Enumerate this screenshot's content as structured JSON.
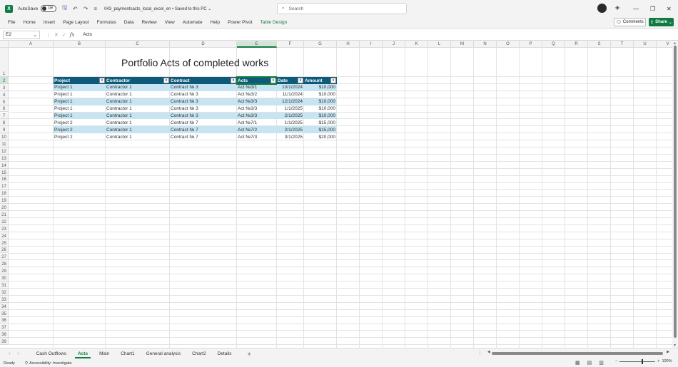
{
  "titlebar": {
    "autosave_label": "AutoSave",
    "autosave_state": "Off",
    "doc_title": "043_paymentsacts_local_excel_en • Saved to this PC ⌄",
    "search_placeholder": "Search"
  },
  "ribbon": {
    "tabs": [
      "File",
      "Home",
      "Insert",
      "Page Layout",
      "Formulas",
      "Data",
      "Review",
      "View",
      "Automate",
      "Help",
      "Power Pivot",
      "Table Design"
    ],
    "comments_label": "Comments",
    "share_label": "Share"
  },
  "formulabar": {
    "name_box": "E2",
    "formula": "Acts"
  },
  "grid": {
    "columns": [
      "A",
      "B",
      "C",
      "D",
      "E",
      "F",
      "G",
      "H",
      "I",
      "J",
      "K",
      "L",
      "M",
      "N",
      "O",
      "P",
      "Q",
      "R",
      "S",
      "T",
      "U",
      "V"
    ],
    "rows": [
      "1",
      "2",
      "3",
      "4",
      "5",
      "6",
      "7",
      "8",
      "9",
      "10",
      "11",
      "12",
      "13",
      "14",
      "15",
      "16",
      "17",
      "18",
      "19",
      "20",
      "21",
      "22",
      "23",
      "24",
      "25",
      "26",
      "27",
      "28",
      "29",
      "30",
      "31",
      "32",
      "33",
      "34",
      "35",
      "36",
      "37",
      "38",
      "39"
    ],
    "selected_column": "E",
    "selected_row": "2"
  },
  "sheet": {
    "title": "Portfolio Acts of completed works",
    "table": {
      "headers": [
        "Project",
        "Contractor",
        "Contract",
        "Acts",
        "Date",
        "Amount"
      ],
      "rows": [
        [
          "Project 1",
          "Contractor 1",
          "Contract № 3",
          "Act №3/1",
          "10/1/2024",
          "$10,000"
        ],
        [
          "Project 1",
          "Contractor 1",
          "Contract № 3",
          "Act №3/2",
          "11/1/2024",
          "$10,000"
        ],
        [
          "Project 1",
          "Contractor 1",
          "Contract № 3",
          "Act №3/3",
          "12/1/2024",
          "$10,000"
        ],
        [
          "Project 1",
          "Contractor 1",
          "Contract № 3",
          "Act №3/3",
          "1/1/2025",
          "$10,000"
        ],
        [
          "Project 1",
          "Contractor 1",
          "Contract № 3",
          "Act №3/3",
          "2/1/2025",
          "$10,000"
        ],
        [
          "Project 2",
          "Contractor 1",
          "Contract № 7",
          "Act №7/1",
          "1/1/2025",
          "$15,000"
        ],
        [
          "Project 2",
          "Contractor 1",
          "Contract № 7",
          "Act №7/2",
          "2/1/2025",
          "$15,000"
        ],
        [
          "Project 2",
          "Contractor 1",
          "Contract № 7",
          "Act №7/3",
          "3/1/2025",
          "$20,000"
        ]
      ]
    }
  },
  "sheet_tabs": [
    "Cash Outflows",
    "Acts",
    "Main",
    "Chart1",
    "General analysis",
    "Chart2",
    "Details"
  ],
  "active_sheet": "Acts",
  "status": {
    "ready": "Ready",
    "accessibility": "Accessibility: Investigate",
    "zoom": "100%"
  },
  "colors": {
    "accent": "#107c41",
    "table_header": "#0d5a7a",
    "table_band": "#c6e4f1"
  }
}
